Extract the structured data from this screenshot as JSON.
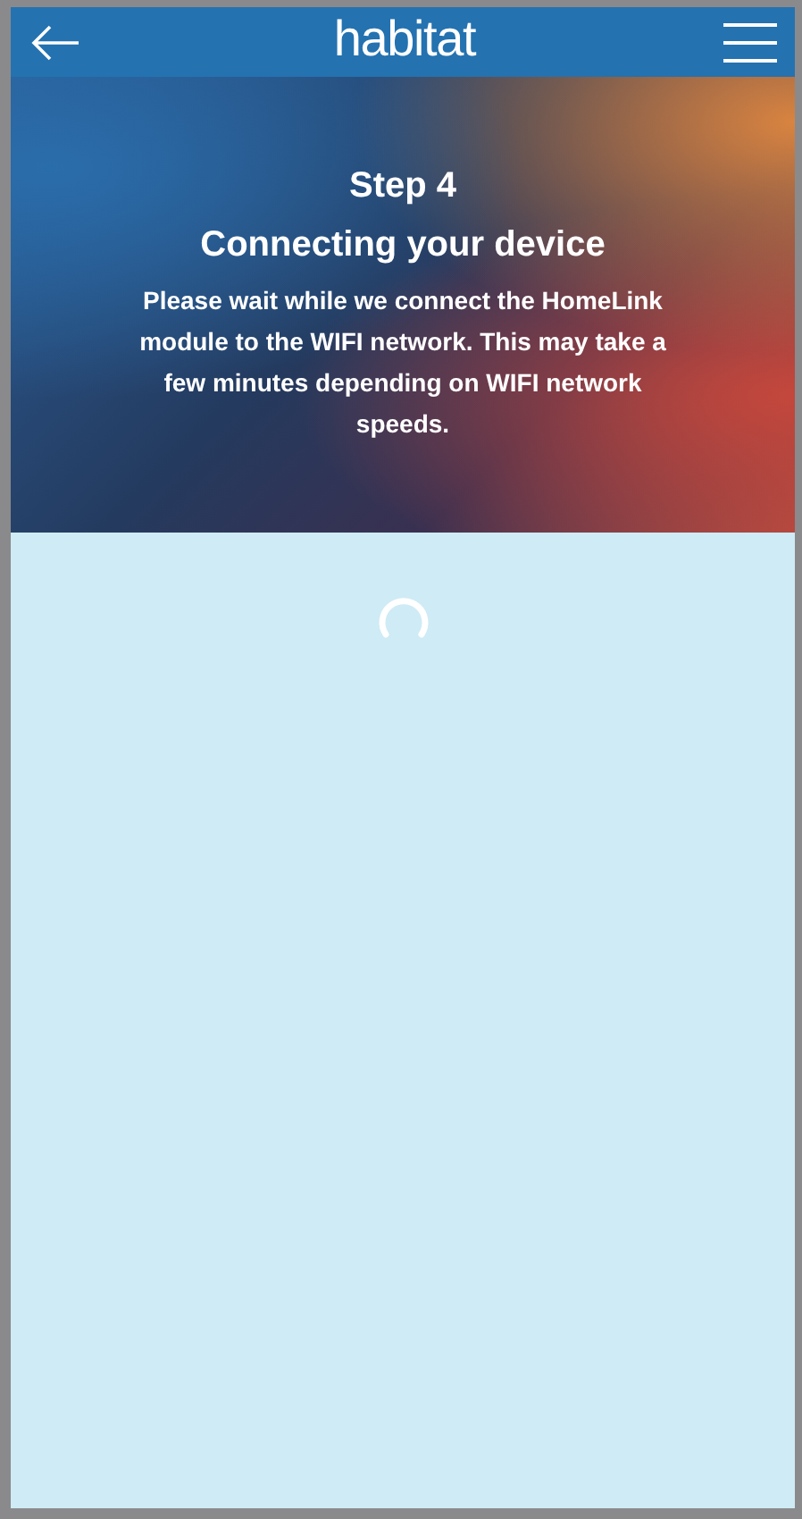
{
  "header": {
    "logo": "habitat"
  },
  "hero": {
    "step": "Step 4",
    "title": "Connecting your device",
    "message": "Please wait while we connect the HomeLink module to the WIFI network. This may take a few minutes depending on WIFI network speeds."
  }
}
